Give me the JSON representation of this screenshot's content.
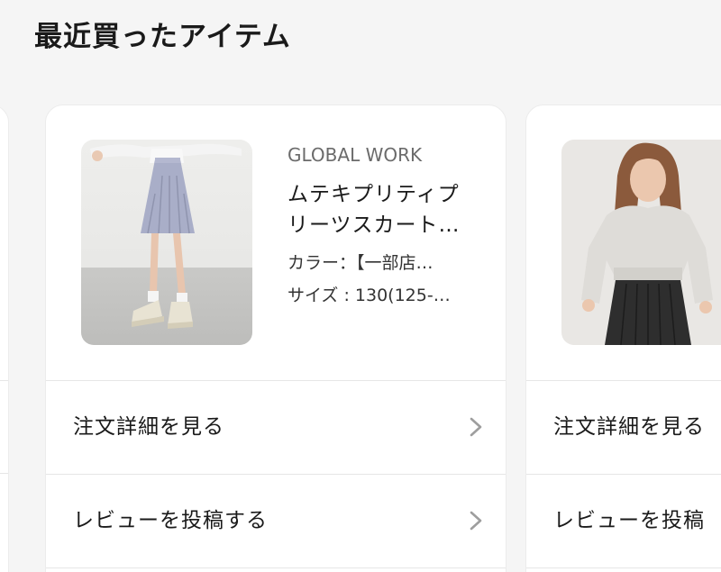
{
  "section": {
    "title": "最近買ったアイテム"
  },
  "items": [
    {
      "brand": "GLOBAL WORK",
      "name_line1": "ムテキプリティプ",
      "name_line2": "リーツスカート…",
      "color_label": "カラー：【一部店…",
      "size_label": "サイズ : 130(125-…",
      "image": "girl-in-lavender-pleated-skirt",
      "actions": {
        "order_detail": "注文詳細を見る",
        "review": "レビューを投稿する"
      }
    },
    {
      "image": "girl-in-gray-sweatshirt-black-skirt",
      "actions": {
        "order_detail": "注文詳細を見る",
        "review": "レビューを投稿"
      }
    }
  ],
  "icons": {
    "chevron": "chevron-right-icon"
  },
  "colors": {
    "background": "#f5f5f5",
    "card": "#ffffff",
    "chevron": "#9e9e9e",
    "brand_text": "#6b6b6b"
  }
}
